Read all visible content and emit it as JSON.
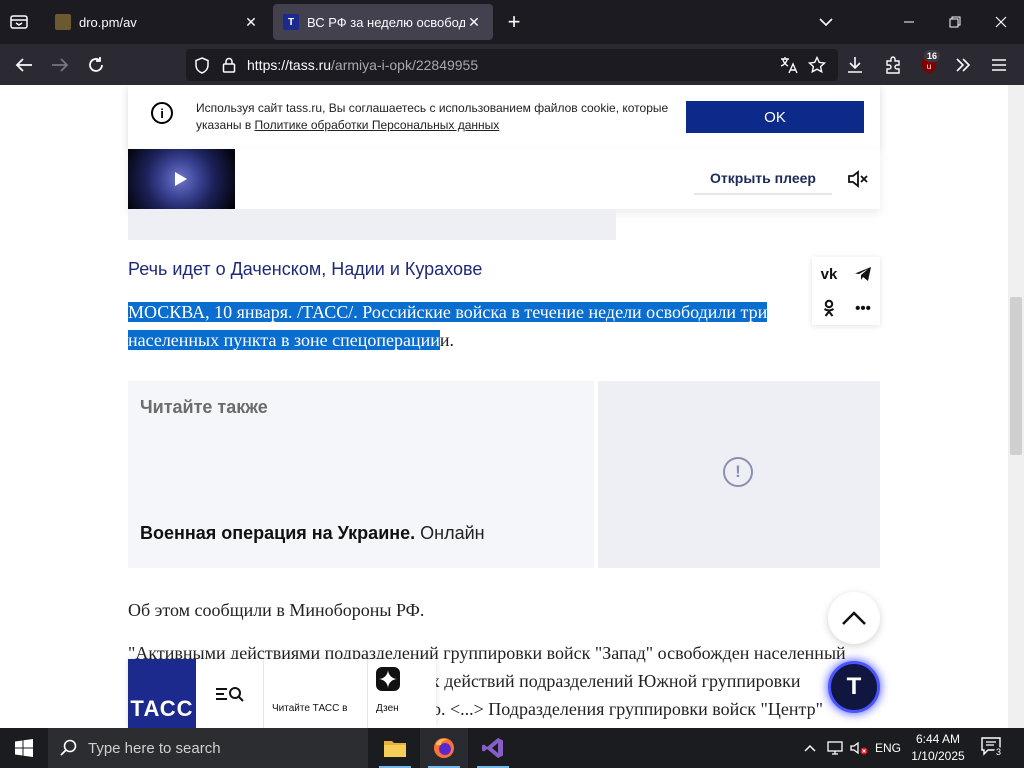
{
  "browser": {
    "tabs": [
      {
        "title": "dro.pm/av",
        "active": false
      },
      {
        "title": "ВС РФ за неделю освободили",
        "active": true
      }
    ],
    "url": {
      "host": "https://tass.ru",
      "path": "/armiya-i-opk/22849955"
    },
    "extensions_badge": "16"
  },
  "cookie_banner": {
    "text": "Используя сайт tass.ru, Вы соглашаетесь с использованием файлов cookie, которые указаны в ",
    "link": "Политике обработки Персональных данных",
    "ok_label": "OK"
  },
  "player": {
    "open_label": "Открыть плеер"
  },
  "article": {
    "subtitle": "Речь идет о Даченском, Надии и Курахове",
    "lead_selected": "МОСКВА, 10 января. /ТАСС/. Российские войска в течение недели освободили три населенных пункта в зоне спецоперации",
    "lead_rest": "и.",
    "read_also": {
      "heading": "Читайте также",
      "title_bold": "Военная операция на Украине.",
      "title_rest": " Онлайн"
    },
    "para1": "Об этом сообщили в Минобороны РФ.",
    "para2_line1": "\"Активными действиями подразделений группировки войск \"Запад\" освобожден населенный",
    "para2_line2": "пункт Даченское. В результате активных действий подразделений Южной группировки",
    "para2_line3": "освобожден населенный пункт Курахово. <...> Подразделения группировки войск \"Центр\""
  },
  "bottom_bar": {
    "logo": "ТАСС",
    "read_label": "Читайте ТАСС в",
    "dzen_label": "Дзен"
  },
  "floating": {
    "t_button": "T"
  },
  "taskbar": {
    "search_placeholder": "Type here to search",
    "language": "ENG",
    "time": "6:44 AM",
    "date": "1/10/2025",
    "notifications": "3"
  }
}
